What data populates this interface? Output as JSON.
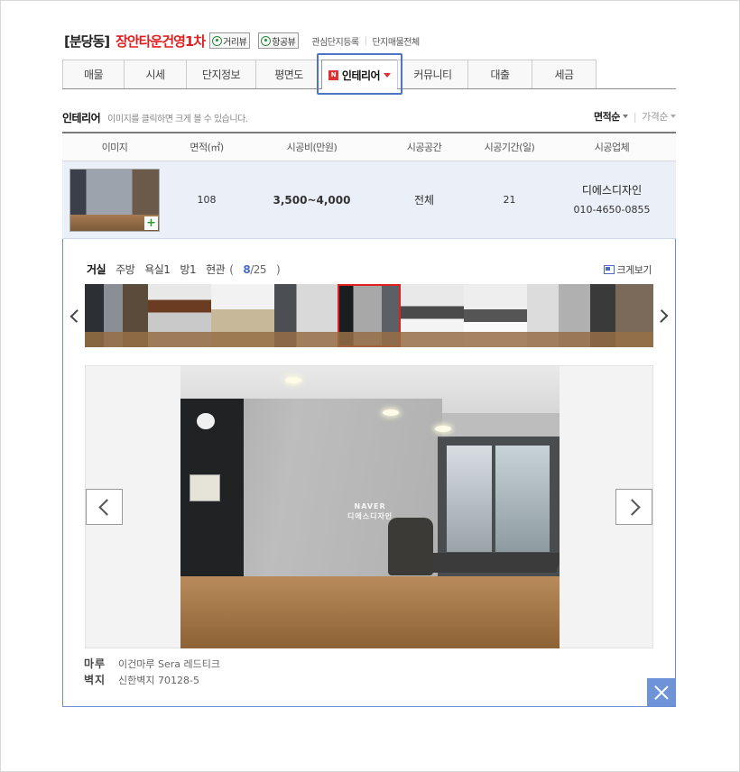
{
  "header": {
    "region": "[분당동]",
    "complex_name": "장안타운건영1차",
    "street_view": "거리뷰",
    "aerial_view": "항공뷰",
    "links": [
      "관심단지등록",
      "단지매물전체"
    ]
  },
  "tabs": [
    {
      "label": "매물",
      "active": false
    },
    {
      "label": "시세",
      "active": false
    },
    {
      "label": "단지정보",
      "active": false
    },
    {
      "label": "평면도",
      "active": false
    },
    {
      "label": "인테리어",
      "active": true,
      "badge": "N"
    },
    {
      "label": "커뮤니티",
      "active": false
    },
    {
      "label": "대출",
      "active": false
    },
    {
      "label": "세금",
      "active": false
    }
  ],
  "section": {
    "title": "인테리어",
    "desc": "이미지를 클릭하면 크게 볼 수 있습니다.",
    "sort_area": "면적순",
    "sort_price": "가격순"
  },
  "table": {
    "headers": [
      "이미지",
      "면적(㎡)",
      "시공비(만원)",
      "시공공간",
      "시공기간(일)",
      "시공업체"
    ],
    "row": {
      "area": "108",
      "cost": "3,500~4,000",
      "space": "전체",
      "period": "21",
      "vendor": "디에스디자인",
      "phone": "010-4650-0855"
    }
  },
  "gallery": {
    "categories": [
      "거실",
      "주방",
      "욕실1",
      "방1",
      "현관"
    ],
    "current_category": "거실",
    "count_current": "8",
    "count_total": "/25",
    "count_open": "(",
    "count_close": ")",
    "big_view": "크게보기",
    "watermark_1": "NAVER",
    "watermark_2": "디에스디자인"
  },
  "specs": [
    {
      "key": "마루",
      "value": "이건마루 Sera 레드티크"
    },
    {
      "key": "벽지",
      "value": "신한벽지 70128-5"
    }
  ],
  "colors": {
    "accent_red": "#e02020",
    "panel_border": "#6c8fd4",
    "row_bg": "#eaeff8",
    "close_bg": "#6f93d8"
  }
}
